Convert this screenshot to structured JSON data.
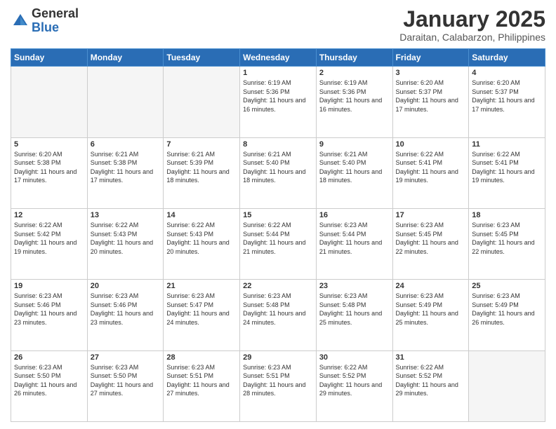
{
  "header": {
    "logo_general": "General",
    "logo_blue": "Blue",
    "month_title": "January 2025",
    "location": "Daraitan, Calabarzon, Philippines"
  },
  "weekdays": [
    "Sunday",
    "Monday",
    "Tuesday",
    "Wednesday",
    "Thursday",
    "Friday",
    "Saturday"
  ],
  "weeks": [
    [
      {
        "day": "",
        "sunrise": "",
        "sunset": "",
        "daylight": ""
      },
      {
        "day": "",
        "sunrise": "",
        "sunset": "",
        "daylight": ""
      },
      {
        "day": "",
        "sunrise": "",
        "sunset": "",
        "daylight": ""
      },
      {
        "day": "1",
        "sunrise": "Sunrise: 6:19 AM",
        "sunset": "Sunset: 5:36 PM",
        "daylight": "Daylight: 11 hours and 16 minutes."
      },
      {
        "day": "2",
        "sunrise": "Sunrise: 6:19 AM",
        "sunset": "Sunset: 5:36 PM",
        "daylight": "Daylight: 11 hours and 16 minutes."
      },
      {
        "day": "3",
        "sunrise": "Sunrise: 6:20 AM",
        "sunset": "Sunset: 5:37 PM",
        "daylight": "Daylight: 11 hours and 17 minutes."
      },
      {
        "day": "4",
        "sunrise": "Sunrise: 6:20 AM",
        "sunset": "Sunset: 5:37 PM",
        "daylight": "Daylight: 11 hours and 17 minutes."
      }
    ],
    [
      {
        "day": "5",
        "sunrise": "Sunrise: 6:20 AM",
        "sunset": "Sunset: 5:38 PM",
        "daylight": "Daylight: 11 hours and 17 minutes."
      },
      {
        "day": "6",
        "sunrise": "Sunrise: 6:21 AM",
        "sunset": "Sunset: 5:38 PM",
        "daylight": "Daylight: 11 hours and 17 minutes."
      },
      {
        "day": "7",
        "sunrise": "Sunrise: 6:21 AM",
        "sunset": "Sunset: 5:39 PM",
        "daylight": "Daylight: 11 hours and 18 minutes."
      },
      {
        "day": "8",
        "sunrise": "Sunrise: 6:21 AM",
        "sunset": "Sunset: 5:40 PM",
        "daylight": "Daylight: 11 hours and 18 minutes."
      },
      {
        "day": "9",
        "sunrise": "Sunrise: 6:21 AM",
        "sunset": "Sunset: 5:40 PM",
        "daylight": "Daylight: 11 hours and 18 minutes."
      },
      {
        "day": "10",
        "sunrise": "Sunrise: 6:22 AM",
        "sunset": "Sunset: 5:41 PM",
        "daylight": "Daylight: 11 hours and 19 minutes."
      },
      {
        "day": "11",
        "sunrise": "Sunrise: 6:22 AM",
        "sunset": "Sunset: 5:41 PM",
        "daylight": "Daylight: 11 hours and 19 minutes."
      }
    ],
    [
      {
        "day": "12",
        "sunrise": "Sunrise: 6:22 AM",
        "sunset": "Sunset: 5:42 PM",
        "daylight": "Daylight: 11 hours and 19 minutes."
      },
      {
        "day": "13",
        "sunrise": "Sunrise: 6:22 AM",
        "sunset": "Sunset: 5:43 PM",
        "daylight": "Daylight: 11 hours and 20 minutes."
      },
      {
        "day": "14",
        "sunrise": "Sunrise: 6:22 AM",
        "sunset": "Sunset: 5:43 PM",
        "daylight": "Daylight: 11 hours and 20 minutes."
      },
      {
        "day": "15",
        "sunrise": "Sunrise: 6:22 AM",
        "sunset": "Sunset: 5:44 PM",
        "daylight": "Daylight: 11 hours and 21 minutes."
      },
      {
        "day": "16",
        "sunrise": "Sunrise: 6:23 AM",
        "sunset": "Sunset: 5:44 PM",
        "daylight": "Daylight: 11 hours and 21 minutes."
      },
      {
        "day": "17",
        "sunrise": "Sunrise: 6:23 AM",
        "sunset": "Sunset: 5:45 PM",
        "daylight": "Daylight: 11 hours and 22 minutes."
      },
      {
        "day": "18",
        "sunrise": "Sunrise: 6:23 AM",
        "sunset": "Sunset: 5:45 PM",
        "daylight": "Daylight: 11 hours and 22 minutes."
      }
    ],
    [
      {
        "day": "19",
        "sunrise": "Sunrise: 6:23 AM",
        "sunset": "Sunset: 5:46 PM",
        "daylight": "Daylight: 11 hours and 23 minutes."
      },
      {
        "day": "20",
        "sunrise": "Sunrise: 6:23 AM",
        "sunset": "Sunset: 5:46 PM",
        "daylight": "Daylight: 11 hours and 23 minutes."
      },
      {
        "day": "21",
        "sunrise": "Sunrise: 6:23 AM",
        "sunset": "Sunset: 5:47 PM",
        "daylight": "Daylight: 11 hours and 24 minutes."
      },
      {
        "day": "22",
        "sunrise": "Sunrise: 6:23 AM",
        "sunset": "Sunset: 5:48 PM",
        "daylight": "Daylight: 11 hours and 24 minutes."
      },
      {
        "day": "23",
        "sunrise": "Sunrise: 6:23 AM",
        "sunset": "Sunset: 5:48 PM",
        "daylight": "Daylight: 11 hours and 25 minutes."
      },
      {
        "day": "24",
        "sunrise": "Sunrise: 6:23 AM",
        "sunset": "Sunset: 5:49 PM",
        "daylight": "Daylight: 11 hours and 25 minutes."
      },
      {
        "day": "25",
        "sunrise": "Sunrise: 6:23 AM",
        "sunset": "Sunset: 5:49 PM",
        "daylight": "Daylight: 11 hours and 26 minutes."
      }
    ],
    [
      {
        "day": "26",
        "sunrise": "Sunrise: 6:23 AM",
        "sunset": "Sunset: 5:50 PM",
        "daylight": "Daylight: 11 hours and 26 minutes."
      },
      {
        "day": "27",
        "sunrise": "Sunrise: 6:23 AM",
        "sunset": "Sunset: 5:50 PM",
        "daylight": "Daylight: 11 hours and 27 minutes."
      },
      {
        "day": "28",
        "sunrise": "Sunrise: 6:23 AM",
        "sunset": "Sunset: 5:51 PM",
        "daylight": "Daylight: 11 hours and 27 minutes."
      },
      {
        "day": "29",
        "sunrise": "Sunrise: 6:23 AM",
        "sunset": "Sunset: 5:51 PM",
        "daylight": "Daylight: 11 hours and 28 minutes."
      },
      {
        "day": "30",
        "sunrise": "Sunrise: 6:22 AM",
        "sunset": "Sunset: 5:52 PM",
        "daylight": "Daylight: 11 hours and 29 minutes."
      },
      {
        "day": "31",
        "sunrise": "Sunrise: 6:22 AM",
        "sunset": "Sunset: 5:52 PM",
        "daylight": "Daylight: 11 hours and 29 minutes."
      },
      {
        "day": "",
        "sunrise": "",
        "sunset": "",
        "daylight": ""
      }
    ]
  ]
}
